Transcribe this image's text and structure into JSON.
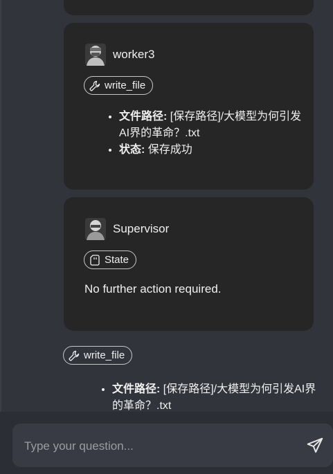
{
  "messages": [
    {
      "agent": "worker3",
      "avatar_icon": "worker-avatar-icon",
      "tool": {
        "label": "write_file",
        "icon": "wrench-icon"
      },
      "details": [
        {
          "key": "文件路径:",
          "value": " [保存路径]/大模型为何引发AI界的革命？.txt"
        },
        {
          "key": "状态:",
          "value": " 保存成功"
        }
      ]
    },
    {
      "agent": "Supervisor",
      "avatar_icon": "supervisor-avatar-icon",
      "tool": {
        "label": "State",
        "icon": "sd-card-icon"
      },
      "text": "No further action required."
    }
  ],
  "final_tool": {
    "label": "write_file",
    "icon": "wrench-icon",
    "details": [
      {
        "key": "文件路径:",
        "value": " [保存路径]/大模型为何引发AI界的革命？.txt"
      }
    ]
  },
  "input": {
    "placeholder": "Type your question...",
    "value": ""
  },
  "send_icon": "send-icon"
}
